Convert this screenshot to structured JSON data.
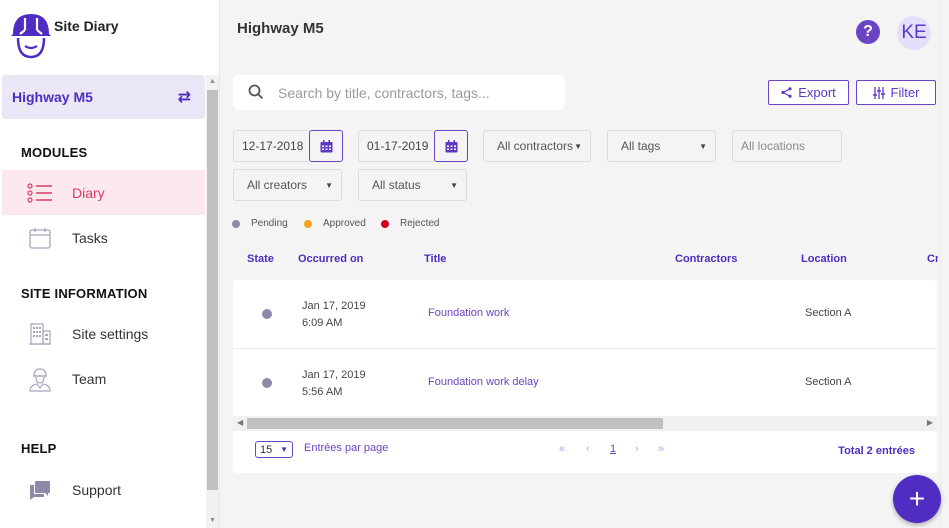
{
  "app": {
    "name": "Site Diary"
  },
  "sidebar": {
    "project": "Highway M5",
    "sections": [
      {
        "title": "MODULES",
        "items": [
          {
            "label": "Diary",
            "icon": "list-icon",
            "active": true
          },
          {
            "label": "Tasks",
            "icon": "calendar-icon",
            "active": false
          }
        ]
      },
      {
        "title": "SITE INFORMATION",
        "items": [
          {
            "label": "Site settings",
            "icon": "building-icon",
            "active": false
          },
          {
            "label": "Team",
            "icon": "worker-icon",
            "active": false
          }
        ]
      },
      {
        "title": "HELP",
        "items": [
          {
            "label": "Support",
            "icon": "chat-icon",
            "active": false
          }
        ]
      }
    ]
  },
  "header": {
    "title": "Highway M5",
    "help_label": "?",
    "avatar_initials": "KE"
  },
  "search": {
    "placeholder": "Search by title, contractors, tags...",
    "value": ""
  },
  "toolbar": {
    "export_label": "Export",
    "filter_label": "Filter"
  },
  "filters": {
    "date_from": "12-17-2018",
    "date_to": "01-17-2019",
    "contractors": "All contractors",
    "tags": "All tags",
    "locations_placeholder": "All locations",
    "creators": "All creators",
    "status": "All status"
  },
  "legend": [
    {
      "label": "Pending",
      "color": "#8e89a8"
    },
    {
      "label": "Approved",
      "color": "#f4a41f"
    },
    {
      "label": "Rejected",
      "color": "#d0021b"
    }
  ],
  "table": {
    "columns": [
      "State",
      "Occurred on",
      "Title",
      "Contractors",
      "Location",
      "Cr"
    ],
    "rows": [
      {
        "state": "Pending",
        "state_color": "#8e89a8",
        "date": "Jan 17, 2019",
        "time": "6:09 AM",
        "title": "Foundation work",
        "contractors": "",
        "location": "Section A"
      },
      {
        "state": "Pending",
        "state_color": "#8e89a8",
        "date": "Jan 17, 2019",
        "time": "5:56 AM",
        "title": "Foundation work delay",
        "contractors": "",
        "location": "Section A"
      }
    ]
  },
  "pagination": {
    "per_page": "15",
    "per_page_label": "Entrées par page",
    "first": "«",
    "prev": "‹",
    "current_page": "1",
    "next": "›",
    "last": "»",
    "total_label": "Total 2 entrées"
  },
  "fab_label": "+",
  "colors": {
    "brand": "#4f2cc2",
    "accent": "#6a44c4",
    "active_nav": "#dc3a66"
  }
}
